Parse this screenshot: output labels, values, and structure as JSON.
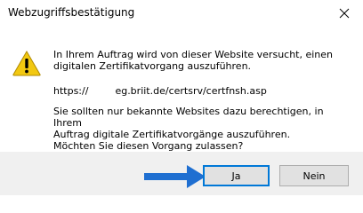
{
  "window": {
    "title": "Webzugriffsbestätigung"
  },
  "icons": {
    "close": "close-icon",
    "warning": "warning-icon",
    "arrow": "arrow-right-icon"
  },
  "message": {
    "paragraph1_line1": "In Ihrem Auftrag wird von dieser Website versucht, einen",
    "paragraph1_line2": "digitalen Zertifikatvorgang auszuführen.",
    "url_prefix": "https://",
    "url_rest": "eg.briit.de/certsrv/certfnsh.asp",
    "paragraph2_line1": "Sie sollten nur bekannte Websites dazu berechtigen, in Ihrem",
    "paragraph2_line2": "Auftrag digitale Zertifikatvorgänge auszuführen.",
    "paragraph2_line3": "Möchten Sie diesen Vorgang zulassen?"
  },
  "buttons": {
    "yes": "Ja",
    "no": "Nein"
  },
  "colors": {
    "warning_fill": "#f2c811",
    "focus_border": "#0078d7",
    "arrow": "#1f6fd1",
    "footer_bg": "#f0f0f0"
  }
}
